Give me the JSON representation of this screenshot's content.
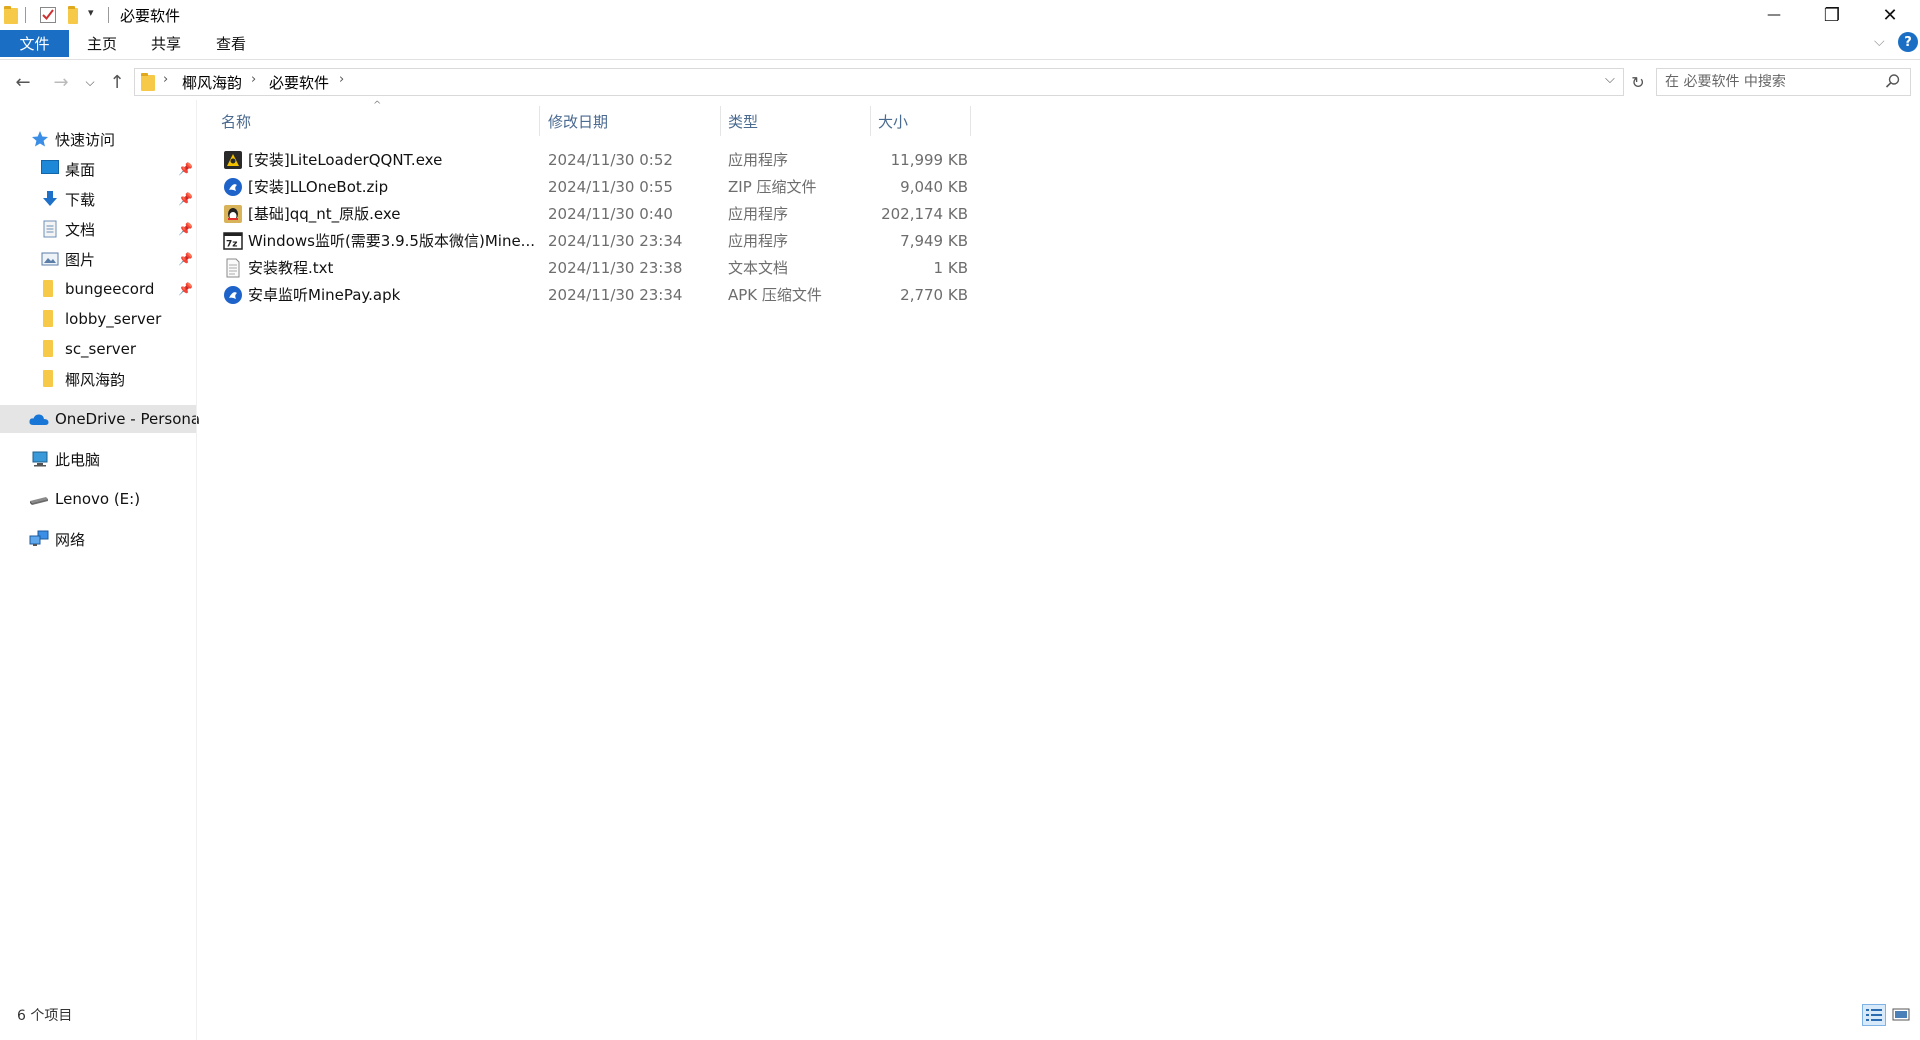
{
  "window": {
    "title": "必要软件",
    "minimize_glyph": "—",
    "maximize_glyph": "❐",
    "close_glyph": "✕"
  },
  "ribbon": {
    "tabs": [
      {
        "label": "文件"
      },
      {
        "label": "主页"
      },
      {
        "label": "共享"
      },
      {
        "label": "查看"
      }
    ]
  },
  "address": {
    "crumbs": [
      "椰风海韵",
      "必要软件"
    ],
    "search_placeholder": "在 必要软件 中搜索"
  },
  "sidebar": {
    "quick_access": "快速访问",
    "pinned": [
      "桌面",
      "下载",
      "文档",
      "图片"
    ],
    "folders": [
      "bungeecord",
      "lobby_server",
      "sc_server",
      "椰风海韵"
    ],
    "onedrive": "OneDrive - Persona",
    "this_pc": "此电脑",
    "drive": "Lenovo (E:)",
    "network": "网络"
  },
  "columns": {
    "name": "名称",
    "date": "修改日期",
    "type": "类型",
    "size": "大小"
  },
  "files": [
    {
      "name": "[安装]LiteLoaderQQNT.exe",
      "date": "2024/11/30 0:52",
      "type": "应用程序",
      "size": "11,999 KB",
      "icon": "app-exe-icon"
    },
    {
      "name": "[安装]LLOneBot.zip",
      "date": "2024/11/30 0:55",
      "type": "ZIP 压缩文件",
      "size": "9,040 KB",
      "icon": "zip-icon"
    },
    {
      "name": "[基础]qq_nt_原版.exe",
      "date": "2024/11/30 0:40",
      "type": "应用程序",
      "size": "202,174 KB",
      "icon": "qq-app-icon"
    },
    {
      "name": "Windows监听(需要3.9.5版本微信)Mine...",
      "date": "2024/11/30 23:34",
      "type": "应用程序",
      "size": "7,949 KB",
      "icon": "sevenzip-app-icon"
    },
    {
      "name": "安装教程.txt",
      "date": "2024/11/30 23:38",
      "type": "文本文档",
      "size": "1 KB",
      "icon": "text-file-icon"
    },
    {
      "name": "安卓监听MinePay.apk",
      "date": "2024/11/30 23:34",
      "type": "APK 压缩文件",
      "size": "2,770 KB",
      "icon": "apk-icon"
    }
  ],
  "status": {
    "count": "6 个项目"
  },
  "colors": {
    "accent": "#1a6fc4",
    "folder": "#f7c948",
    "header_text": "#4a6a90"
  }
}
